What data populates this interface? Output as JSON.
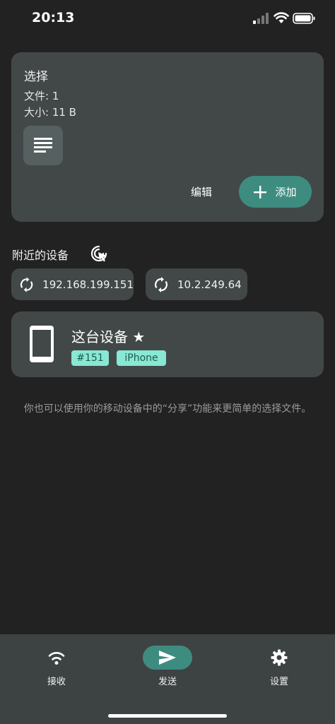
{
  "status_bar": {
    "time": "20:13"
  },
  "selection": {
    "title": "选择",
    "files": "文件: 1",
    "size": "大小: 11 B",
    "edit_label": "编辑",
    "add_label": "添加"
  },
  "nearby": {
    "title": "附近的设备",
    "ips": [
      "192.168.199.151",
      "10.2.249.64"
    ]
  },
  "device": {
    "name": "这台设备 ★",
    "id_tag": "#151",
    "model_tag": "iPhone"
  },
  "hint": "你也可以使用你的移动设备中的“分享”功能来更简单的选择文件。",
  "nav": {
    "receive": "接收",
    "send": "发送",
    "settings": "设置"
  },
  "colors": {
    "accent": "#3e8c80",
    "card": "#424848",
    "tag": "#88e8d4",
    "background": "#222222"
  }
}
